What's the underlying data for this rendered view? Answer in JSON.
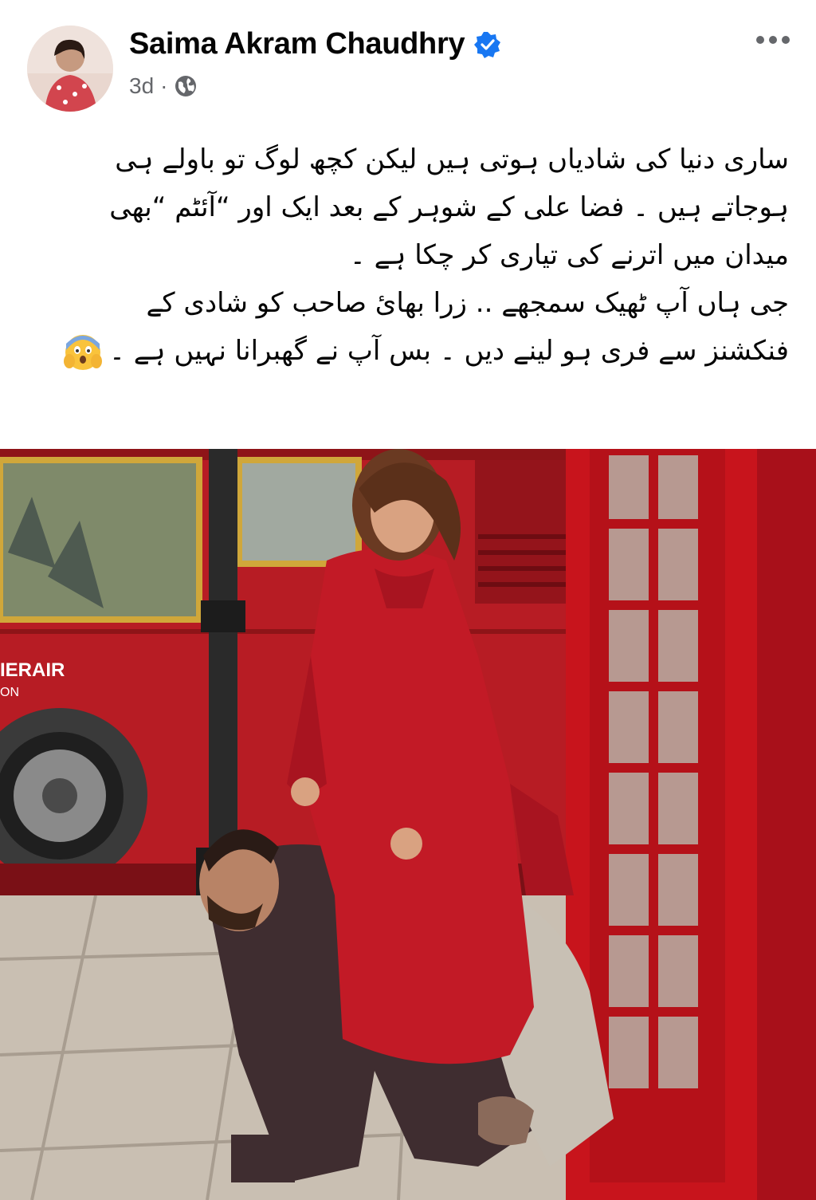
{
  "post": {
    "author_name": "Saima Akram Chaudhry",
    "timestamp": "3d",
    "separator": "·",
    "audience_icon": "globe-icon",
    "verified_icon": "verified-badge-icon",
    "more_icon": "more-options-icon",
    "text_lines": [
      "ساری دنیا کی شادیاں ہوتی ہیں لیکن کچھ لوگ تو باولے ہی",
      "ہوجاتے ہیں ۔ فضا علی کے شوہر کے بعد ایک اور “آئٹم “بھی",
      "میدان میں اترنے کی تیاری کر چکا ہے ۔",
      "جی ہاں آپ ٹھیک سمجھے .. زرا بھائ صاحب کو شادی کے",
      "فنکشنز سے فری ہو لینے دیں ۔ بس آپ نے گھبرانا نہیں ہے ۔"
    ],
    "emoji_icon": "scared-face-emoji-icon",
    "photo": {
      "bus_sign_text": "IERAIR",
      "bus_sign_subtext": "ON"
    }
  },
  "colors": {
    "name": "#050505",
    "meta": "#65676b",
    "verified": "#1877f2",
    "bus_red": "#b71c24",
    "booth_red": "#c8141c"
  }
}
